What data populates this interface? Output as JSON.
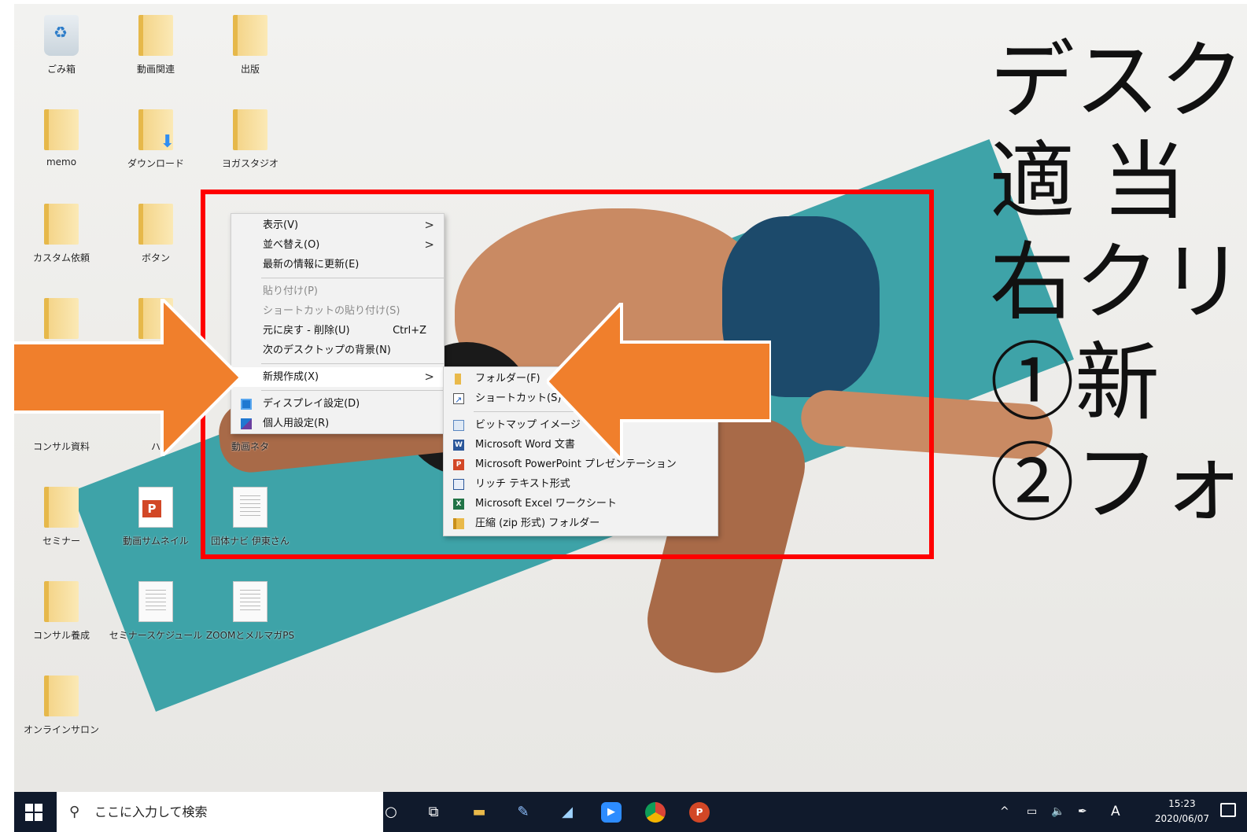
{
  "desktop_icons": [
    {
      "label": "ごみ箱",
      "icon": "recycle-bin-icon"
    },
    {
      "label": "動画関連",
      "icon": "folder-icon"
    },
    {
      "label": "出版",
      "icon": "folder-icon"
    },
    {
      "label": "memo",
      "icon": "folder-icon"
    },
    {
      "label": "ダウンロード",
      "icon": "download-folder-icon"
    },
    {
      "label": "ヨガスタジオ",
      "icon": "folder-icon"
    },
    {
      "label": "カスタム依頼",
      "icon": "folder-icon"
    },
    {
      "label": "ボタン",
      "icon": "folder-icon"
    },
    {
      "label": "",
      "icon": "folder-icon"
    },
    {
      "label": "",
      "icon": "folder-icon"
    },
    {
      "label": "コンサル資料",
      "icon": "folder-icon"
    },
    {
      "label": "ハ",
      "icon": "folder-icon"
    },
    {
      "label": "動画ネタ",
      "icon": "folder-icon"
    },
    {
      "label": "セミナー",
      "icon": "folder-icon"
    },
    {
      "label": "動画サムネイル",
      "icon": "powerpoint-file-icon"
    },
    {
      "label": "団体ナビ 伊東さん",
      "icon": "document-icon"
    },
    {
      "label": "コンサル養成",
      "icon": "folder-icon"
    },
    {
      "label": "セミナースケジュール",
      "icon": "document-icon"
    },
    {
      "label": "ZOOMとメルマガPS",
      "icon": "document-icon"
    },
    {
      "label": "オンラインサロン",
      "icon": "folder-icon"
    }
  ],
  "context_menu": {
    "items": [
      {
        "label": "表示(V)",
        "submenu": true
      },
      {
        "label": "並べ替え(O)",
        "submenu": true
      },
      {
        "label": "最新の情報に更新(E)"
      },
      {
        "label": "貼り付け(P)",
        "disabled": true
      },
      {
        "label": "ショートカットの貼り付け(S)",
        "disabled": true
      },
      {
        "label": "元に戻す - 削除(U)",
        "shortcut": "Ctrl+Z"
      },
      {
        "label": "次のデスクトップの背景(N)"
      },
      {
        "label": "新規作成(X)",
        "submenu": true,
        "highlighted": true
      },
      {
        "label": "ディスプレイ設定(D)",
        "icon": "display-settings-icon"
      },
      {
        "label": "個人用設定(R)",
        "icon": "personalize-icon"
      }
    ]
  },
  "submenu_new": {
    "items": [
      {
        "label": "フォルダー(F)",
        "icon": "folder-icon"
      },
      {
        "label": "ショートカット(S)",
        "icon": "shortcut-icon"
      },
      {
        "label": "ビットマップ イメージ",
        "icon": "bitmap-icon"
      },
      {
        "label": "Microsoft Word 文書",
        "icon": "word-icon"
      },
      {
        "label": "Microsoft PowerPoint プレゼンテーション",
        "icon": "powerpoint-icon"
      },
      {
        "label": "リッチ テキスト形式",
        "icon": "rich-text-icon"
      },
      {
        "label": "Microsoft Excel ワークシート",
        "icon": "excel-icon"
      },
      {
        "label": "圧縮 (zip 形式) フォルダー",
        "icon": "zip-folder-icon"
      }
    ]
  },
  "annotation": {
    "lines": [
      "デスク",
      "適 当",
      "右クリ",
      "①新",
      "②フォ"
    ]
  },
  "taskbar": {
    "search_placeholder": "ここに入力して検索",
    "ime": "A",
    "time": "15:23",
    "date": "2020/06/07"
  },
  "colors": {
    "highlight_border": "#ff0000",
    "arrow": "#f07f2c",
    "taskbar": "#101a2c",
    "mat": "#3ea3a8"
  }
}
